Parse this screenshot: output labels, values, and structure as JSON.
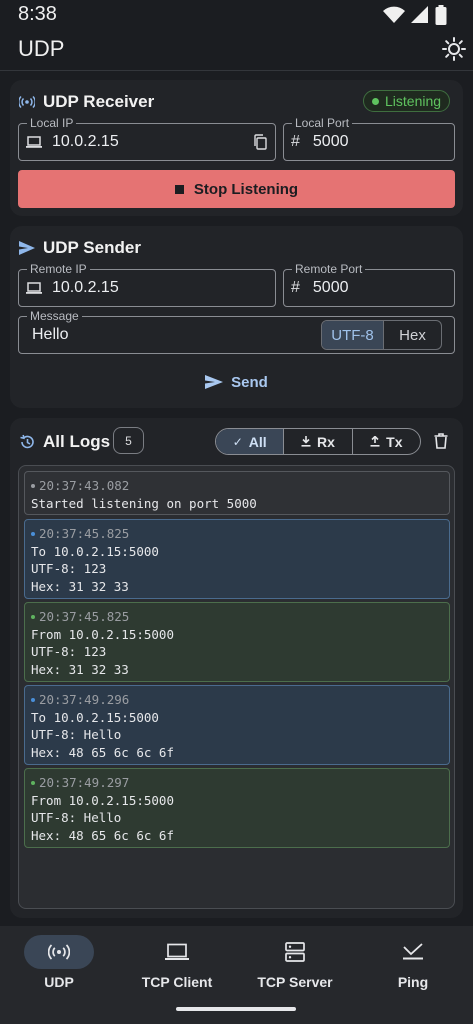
{
  "status": {
    "time": "8:38"
  },
  "app": {
    "title": "UDP"
  },
  "receiver": {
    "title": "UDP Receiver",
    "status_badge": "Listening",
    "local_ip_label": "Local IP",
    "local_ip": "10.0.2.15",
    "local_port_label": "Local Port",
    "local_port": "5000",
    "stop_label": "Stop Listening"
  },
  "sender": {
    "title": "UDP Sender",
    "remote_ip_label": "Remote IP",
    "remote_ip": "10.0.2.15",
    "remote_port_label": "Remote Port",
    "remote_port": "5000",
    "message_label": "Message",
    "message": "Hello",
    "encoding_options": [
      "UTF-8",
      "Hex"
    ],
    "send_label": "Send"
  },
  "logs": {
    "title": "All Logs",
    "count": "5",
    "filters": [
      "All",
      "Rx",
      "Tx"
    ],
    "entries": [
      {
        "kind": "sys",
        "time": "20:37:43.082",
        "lines": [
          "Started listening on port 5000"
        ]
      },
      {
        "kind": "tx",
        "time": "20:37:45.825",
        "lines": [
          "To 10.0.2.15:5000",
          "UTF-8: 123",
          "Hex: 31 32 33"
        ]
      },
      {
        "kind": "rx",
        "time": "20:37:45.825",
        "lines": [
          "From 10.0.2.15:5000",
          "UTF-8: 123",
          "Hex: 31 32 33"
        ]
      },
      {
        "kind": "tx",
        "time": "20:37:49.296",
        "lines": [
          "To 10.0.2.15:5000",
          "UTF-8: Hello",
          "Hex: 48 65 6c 6c 6f"
        ]
      },
      {
        "kind": "rx",
        "time": "20:37:49.297",
        "lines": [
          "From 10.0.2.15:5000",
          "UTF-8: Hello",
          "Hex: 48 65 6c 6c 6f"
        ]
      }
    ]
  },
  "nav": {
    "items": [
      "UDP",
      "TCP Client",
      "TCP Server",
      "Ping"
    ]
  },
  "colors": {
    "listening": "#5fc35f",
    "stop": "#e57373",
    "accent": "#a9c8f0",
    "tx": "#4a8fd8",
    "rx": "#5fb35f"
  }
}
